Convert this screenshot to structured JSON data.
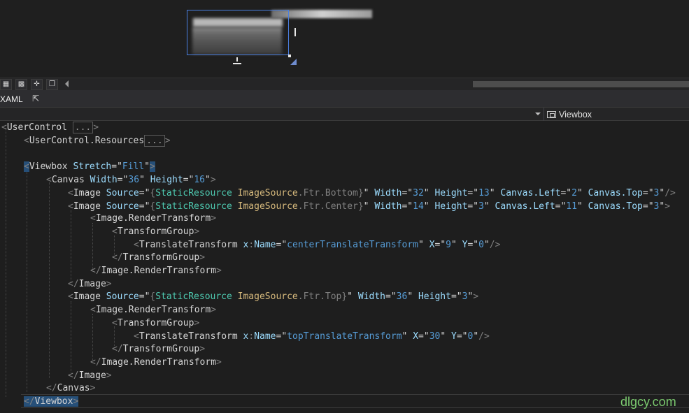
{
  "toolbar": {
    "btn1_icon": "grid-icon",
    "btn2_icon": "checker-icon",
    "btn3_icon": "snap-icon",
    "btn4_icon": "paste-icon"
  },
  "tabs": {
    "xaml": "XAML"
  },
  "nav": {
    "element": "Viewbox"
  },
  "code": {
    "l1": {
      "open": "<",
      "el": "UserControl",
      "box": "...",
      "close": ">"
    },
    "l2": {
      "open": "<",
      "el": "UserControl.Resources",
      "box": "...",
      "close": ">"
    },
    "l4": {
      "open": "<",
      "el": "Viewbox",
      "a1": "Stretch",
      "v1": "Fill",
      "close": ">"
    },
    "l5": {
      "open": "<",
      "el": "Canvas",
      "a1": "Width",
      "v1": "36",
      "a2": "Height",
      "v2": "16",
      "close": ">"
    },
    "l6": {
      "el": "Image",
      "a1": "Source",
      "m1": "StaticResource",
      "m2": "ImageSource",
      "m3": ".Ftr.Bottom",
      "a2": "Width",
      "v2": "32",
      "a3": "Height",
      "v3": "13",
      "a4": "Canvas.Left",
      "v4": "2",
      "a5": "Canvas.Top",
      "v5": "3",
      "close": "/>"
    },
    "l7": {
      "el": "Image",
      "a1": "Source",
      "m1": "StaticResource",
      "m2": "ImageSource",
      "m3": ".Ftr.Center",
      "a2": "Width",
      "v2": "14",
      "a3": "Height",
      "v3": "3",
      "a4": "Canvas.Left",
      "v4": "11",
      "a5": "Canvas.Top",
      "v5": "3",
      "close": ">"
    },
    "l8": {
      "el": "Image.RenderTransform"
    },
    "l9": {
      "el": "TransformGroup"
    },
    "l10": {
      "el": "TranslateTransform",
      "ns": "x",
      "a1": "Name",
      "v1": "centerTranslateTransform",
      "a2": "X",
      "v2": "9",
      "a3": "Y",
      "v3": "0",
      "close": "/>"
    },
    "l11": {
      "el": "TransformGroup"
    },
    "l12": {
      "el": "Image.RenderTransform"
    },
    "l13": {
      "el": "Image"
    },
    "l14": {
      "el": "Image",
      "a1": "Source",
      "m1": "StaticResource",
      "m2": "ImageSource",
      "m3": ".Ftr.Top",
      "a2": "Width",
      "v2": "36",
      "a3": "Height",
      "v3": "3",
      "close": ">"
    },
    "l15": {
      "el": "Image.RenderTransform"
    },
    "l16": {
      "el": "TransformGroup"
    },
    "l17": {
      "el": "TranslateTransform",
      "ns": "x",
      "a1": "Name",
      "v1": "topTranslateTransform",
      "a2": "X",
      "v2": "30",
      "a3": "Y",
      "v3": "0",
      "close": "/>"
    },
    "l18": {
      "el": "TransformGroup"
    },
    "l19": {
      "el": "Image.RenderTransform"
    },
    "l20": {
      "el": "Image"
    },
    "l21": {
      "el": "Canvas"
    },
    "l22": {
      "el": "Viewbox"
    }
  },
  "watermark": "dlgcy.com"
}
